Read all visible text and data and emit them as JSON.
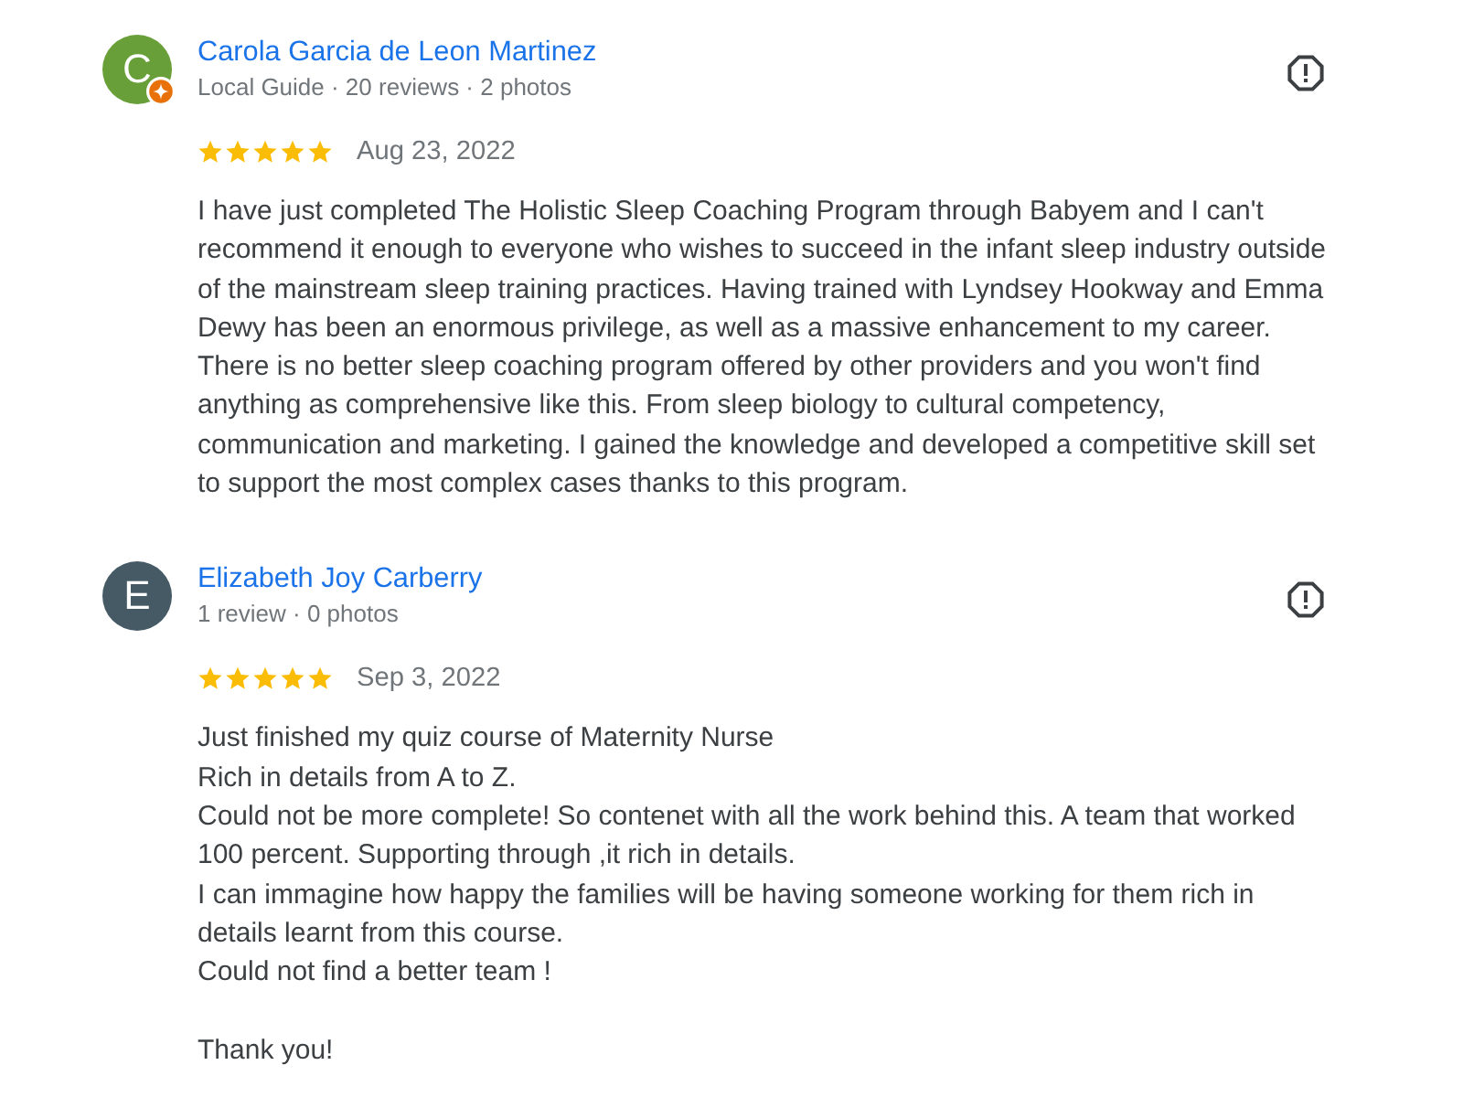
{
  "reviews": [
    {
      "avatar": {
        "initial": "C",
        "color": "#689f38",
        "local_guide": true
      },
      "name": "Carola Garcia de Leon Martinez",
      "meta": "Local Guide · 20 reviews · 2 photos",
      "stars": 5,
      "date": "Aug 23, 2022",
      "text": "I have just completed The Holistic Sleep Coaching Program through Babyem and I can't recommend it enough to everyone who wishes to succeed in the infant sleep industry outside of the mainstream sleep training practices. Having trained with Lyndsey Hookway and Emma Dewy has been an enormous privilege, as well as a massive enhancement to my career. There is no better sleep coaching program offered by other providers and you won't find anything as comprehensive like this. From sleep biology to cultural competency, communication and marketing. I gained the knowledge and developed a competitive skill set to support the most complex cases thanks to this program."
    },
    {
      "avatar": {
        "initial": "E",
        "color": "#455a64",
        "local_guide": false
      },
      "name": "Elizabeth Joy Carberry",
      "meta": "1 review · 0 photos",
      "stars": 5,
      "date": "Sep 3, 2022",
      "text": "Just finished my quiz course of Maternity Nurse\nRich in details from A to Z.\nCould not be more complete! So contenet with all the work behind this. A team that worked 100 percent. Supporting through ,it rich in details.\nI can immagine how happy the families will be having someone working for them rich in details learnt from this course.\nCould not find a better team !\n\nThank you!"
    }
  ]
}
